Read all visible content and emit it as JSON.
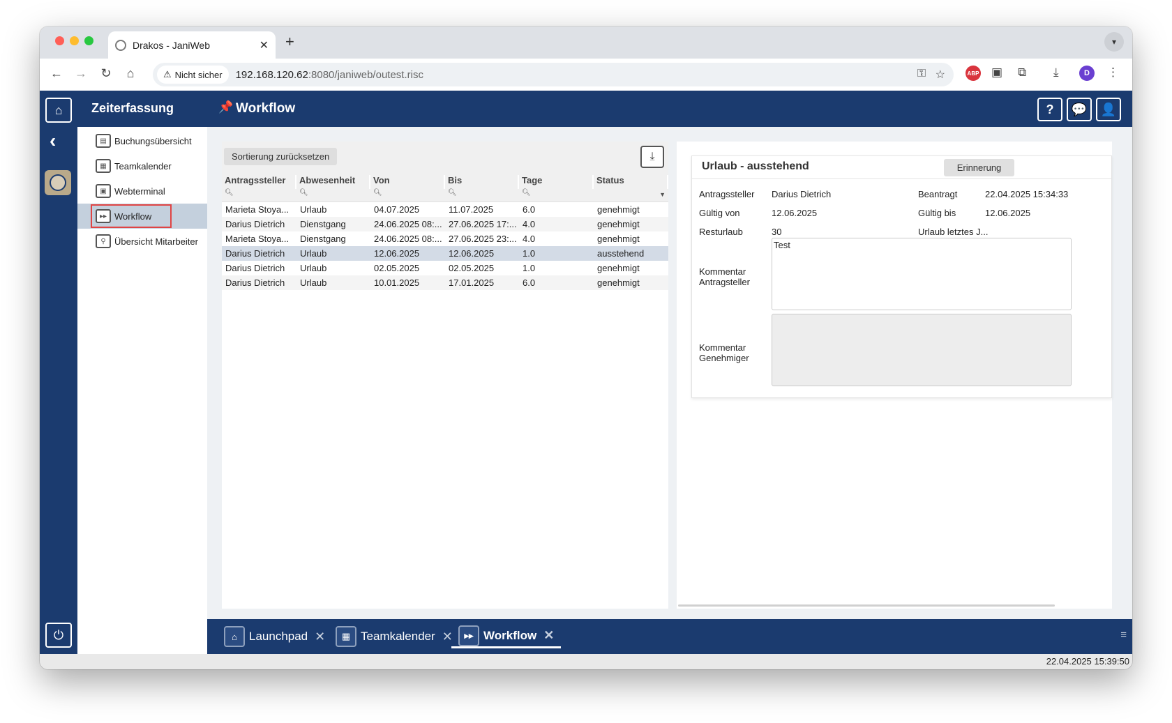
{
  "browser": {
    "tab_title": "Drakos - JaniWeb",
    "tab_close": "✕",
    "new_tab": "+",
    "security_label": "Nicht sicher",
    "url_host": "192.168.120.62",
    "url_path": ":8080/janiweb/outest.risc",
    "profile_initial": "D",
    "abp_label": "ABP"
  },
  "app": {
    "module_title": "Zeiterfassung",
    "page_title": "Workflow"
  },
  "sidebar": {
    "items": [
      {
        "label": "Buchungsübersicht"
      },
      {
        "label": "Teamkalender"
      },
      {
        "label": "Webterminal"
      },
      {
        "label": "Workflow"
      },
      {
        "label": "Übersicht Mitarbeiter"
      }
    ]
  },
  "list": {
    "reset_label": "Sortierung zurücksetzen",
    "columns": [
      "Antragssteller",
      "Abwesenheit",
      "Von",
      "Bis",
      "Tage",
      "Status"
    ],
    "rows": [
      [
        "Marieta Stoya...",
        "Urlaub",
        "04.07.2025",
        "11.07.2025",
        "6.0",
        "genehmigt"
      ],
      [
        "Darius Dietrich",
        "Dienstgang",
        "24.06.2025 08:...",
        "27.06.2025 17:...",
        "4.0",
        "genehmigt"
      ],
      [
        "Marieta Stoya...",
        "Dienstgang",
        "24.06.2025 08:...",
        "27.06.2025 23:...",
        "4.0",
        "genehmigt"
      ],
      [
        "Darius Dietrich",
        "Urlaub",
        "12.06.2025",
        "12.06.2025",
        "1.0",
        "ausstehend"
      ],
      [
        "Darius Dietrich",
        "Urlaub",
        "02.05.2025",
        "02.05.2025",
        "1.0",
        "genehmigt"
      ],
      [
        "Darius Dietrich",
        "Urlaub",
        "10.01.2025",
        "17.01.2025",
        "6.0",
        "genehmigt"
      ]
    ],
    "selected_row": 3
  },
  "detail": {
    "title": "Urlaub - ausstehend",
    "remind_label": "Erinnerung",
    "applicant_label": "Antragssteller",
    "applicant_value": "Darius Dietrich",
    "requested_label": "Beantragt",
    "requested_value": "22.04.2025 15:34:33",
    "valid_from_label": "Gültig von",
    "valid_from_value": "12.06.2025",
    "valid_to_label": "Gültig bis",
    "valid_to_value": "12.06.2025",
    "rest_label": "Resturlaub",
    "rest_value": "30",
    "last_year_label": "Urlaub letztes J...",
    "comment_applicant_label_1": "Kommentar",
    "comment_applicant_label_2": "Antragsteller",
    "comment_applicant_value": "Test",
    "comment_approver_label_1": "Kommentar",
    "comment_approver_label_2": "Genehmiger",
    "comment_approver_value": ""
  },
  "bottom_tabs": [
    {
      "label": "Launchpad"
    },
    {
      "label": "Teamkalender"
    },
    {
      "label": "Workflow"
    }
  ],
  "statusbar": {
    "datetime": "22.04.2025 15:39:50"
  },
  "colors": {
    "brand": "#1b3b6f",
    "selected_row": "#d3dbe6",
    "highlight_border": "#e04444"
  }
}
